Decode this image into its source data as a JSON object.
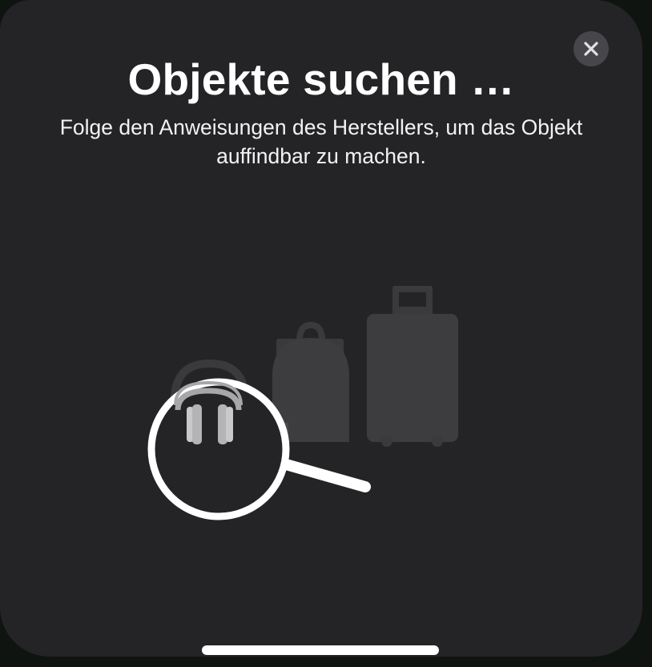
{
  "sheet": {
    "title": "Objekte suchen …",
    "subtitle": "Folge den Anweisungen des Herstellers, um das Objekt auffindbar zu machen."
  },
  "icons": {
    "close": "close-icon",
    "headphones": "headphones-icon",
    "backpack": "backpack-icon",
    "suitcase": "suitcase-icon",
    "magnifier": "magnifying-glass-icon"
  },
  "colors": {
    "sheet_background": "#242426",
    "close_button": "#46464b",
    "text": "#ffffff",
    "illustration_gray": "#3d3d40"
  }
}
